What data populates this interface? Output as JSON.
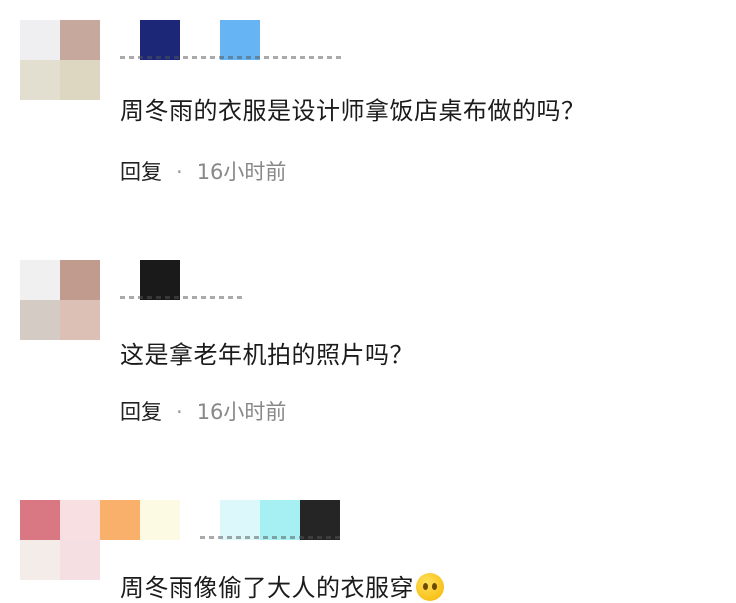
{
  "comments": [
    {
      "text": "周冬雨的衣服是设计师拿饭店桌布做的吗？",
      "reply_label": "回复",
      "separator": "·",
      "time": "16小时前"
    },
    {
      "text": "这是拿老年机拍的照片吗？",
      "reply_label": "回复",
      "separator": "·",
      "time": "16小时前"
    },
    {
      "text": "周冬雨像偷了大人的衣服穿",
      "emoji_icon": "crying-face-icon"
    }
  ],
  "colors": {
    "avatar1": [
      "#efeff1",
      "#c7a89c",
      "#e2dfd1",
      "#ddd6c0"
    ],
    "name1": [
      "#1c2777",
      "#66b4f3"
    ],
    "avatar2": [
      "#f0f0f0",
      "#c19c8e",
      "#d4cbc4",
      "#dcc0b5"
    ],
    "name2": [
      "#1a1a1a"
    ],
    "avatar3": [
      "#d97883",
      "#f8dfe2",
      "#f3ece8",
      "#f6dfe3"
    ],
    "name3": [
      "#fbdde3",
      "#f9b06a",
      "#fdfae3",
      "#dcf8fb",
      "#a6f0f3",
      "#252525"
    ]
  }
}
